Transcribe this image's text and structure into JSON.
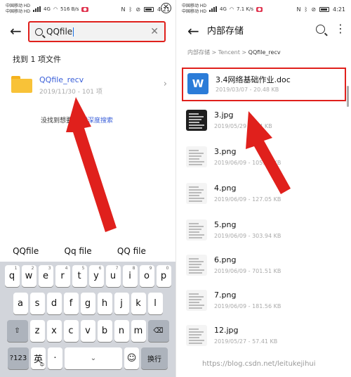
{
  "status_left": {
    "carrier1": "中国移动 HD",
    "carrier2": "中国移动 HD",
    "net": "4G",
    "speed": "516 B/s",
    "time": "4:21"
  },
  "status_right": {
    "carrier1": "中国移动 HD",
    "carrier2": "中国移动 HD",
    "net": "4G",
    "speed": "7.1 K/s",
    "time": "4:21"
  },
  "search": {
    "query": "QQfile",
    "found_label": "找到 1 项文件",
    "result": {
      "name": "QQfile_recv",
      "date": "2019/11/30",
      "count": "101 项"
    },
    "not_found_text": "没找到想要",
    "not_found_link": "试试深度搜索"
  },
  "suggestions": [
    "QQfile",
    "Qq file",
    "QQ file"
  ],
  "keyboard": {
    "row1": [
      {
        "k": "q",
        "n": "1"
      },
      {
        "k": "w",
        "n": "2"
      },
      {
        "k": "e",
        "n": "3"
      },
      {
        "k": "r",
        "n": "4"
      },
      {
        "k": "t",
        "n": "5"
      },
      {
        "k": "y",
        "n": "6"
      },
      {
        "k": "u",
        "n": "7"
      },
      {
        "k": "i",
        "n": "8"
      },
      {
        "k": "o",
        "n": "9"
      },
      {
        "k": "p",
        "n": "0"
      }
    ],
    "row2": [
      "a",
      "s",
      "d",
      "f",
      "g",
      "h",
      "j",
      "k",
      "l"
    ],
    "row3": [
      "z",
      "x",
      "c",
      "v",
      "b",
      "n",
      "m"
    ],
    "symbols_label": "?123",
    "lang_label": "英",
    "lang_sub": "中",
    "period_label": "·",
    "enter_label": "换行"
  },
  "storage": {
    "title": "内部存储",
    "breadcrumb": [
      "内部存储",
      "Tencent",
      "QQfile_recv"
    ],
    "files": [
      {
        "name": "3.4网络基础作业.doc",
        "date": "2019/03/07",
        "size": "20.48 KB",
        "icon": "word-icon"
      },
      {
        "name": "3.jpg",
        "date": "2019/05/29",
        "size": "124 KB",
        "icon": "image-thumb"
      },
      {
        "name": "3.png",
        "date": "2019/06/09",
        "size": "105.32 KB",
        "icon": "image-thumb"
      },
      {
        "name": "4.png",
        "date": "2019/06/09",
        "size": "127.05 KB",
        "icon": "image-thumb"
      },
      {
        "name": "5.png",
        "date": "2019/06/09",
        "size": "303.94 KB",
        "icon": "image-thumb"
      },
      {
        "name": "6.png",
        "date": "2019/06/09",
        "size": "701.51 KB",
        "icon": "image-thumb"
      },
      {
        "name": "7.png",
        "date": "2019/06/09",
        "size": "181.56 KB",
        "icon": "image-thumb"
      },
      {
        "name": "12.jpg",
        "date": "2019/05/27",
        "size": "57.41 KB",
        "icon": "image-thumb"
      }
    ]
  },
  "watermark": "https://blog.csdn.net/leitukejihui",
  "colors": {
    "highlight": "#e0201c",
    "link": "#3a5fd9",
    "folder": "#f8c238",
    "word": "#2b7cd8"
  }
}
